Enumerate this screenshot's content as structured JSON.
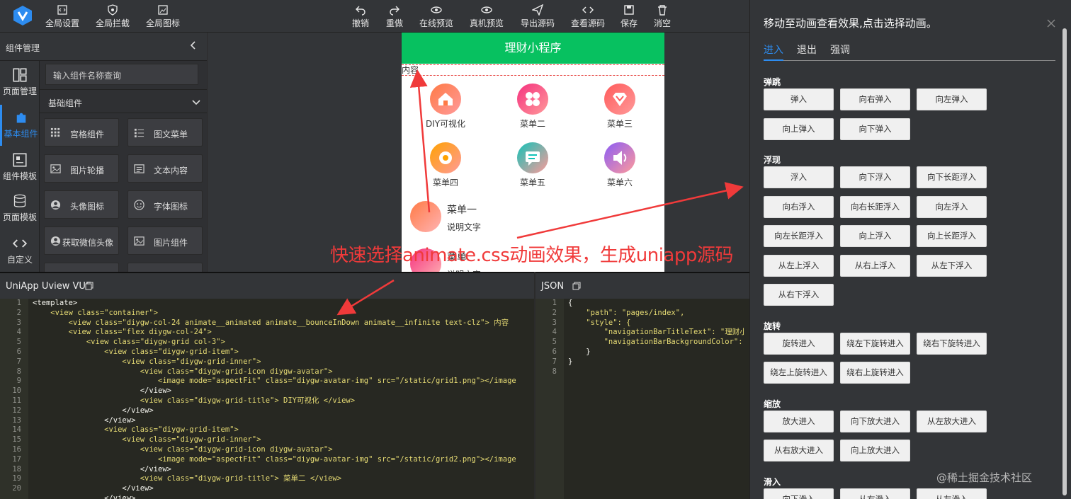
{
  "toolbar": {
    "left": [
      {
        "label": "全局设置",
        "icon": "code-file-icon"
      },
      {
        "label": "全局拦截",
        "icon": "shield-icon"
      },
      {
        "label": "全局图标",
        "icon": "image-box-icon"
      }
    ],
    "center": [
      {
        "label": "撤销",
        "icon": "undo-icon"
      },
      {
        "label": "重做",
        "icon": "redo-icon"
      },
      {
        "label": "在线预览",
        "icon": "eye-icon"
      },
      {
        "label": "真机预览",
        "icon": "eye-icon"
      },
      {
        "label": "导出源码",
        "icon": "send-icon"
      },
      {
        "label": "查看源码",
        "icon": "code-icon"
      },
      {
        "label": "保存",
        "icon": "save-icon"
      },
      {
        "label": "消空",
        "icon": "trash-icon"
      }
    ]
  },
  "sidebar": {
    "header": "组件管理",
    "items": [
      {
        "label": "页面管理",
        "icon": "layout-icon"
      },
      {
        "label": "基本组件",
        "icon": "puzzle-icon",
        "active": true
      },
      {
        "label": "组件模板",
        "icon": "template-icon"
      },
      {
        "label": "页面模板",
        "icon": "database-icon"
      },
      {
        "label": "自定义",
        "icon": "code-icon"
      }
    ]
  },
  "components": {
    "search_placeholder": "输入组件名称查询",
    "category": "基础组件",
    "items": [
      {
        "label": "宫格组件",
        "icon": "grid-icon"
      },
      {
        "label": "图文菜单",
        "icon": "list-icon"
      },
      {
        "label": "图片轮播",
        "icon": "image-icon"
      },
      {
        "label": "文本内容",
        "icon": "text-icon"
      },
      {
        "label": "头像图标",
        "icon": "avatar-icon"
      },
      {
        "label": "字体图标",
        "icon": "smile-icon"
      },
      {
        "label": "获取微信头像",
        "icon": "avatar-icon"
      },
      {
        "label": "图片组件",
        "icon": "image-icon"
      }
    ]
  },
  "phone": {
    "nav_title": "理财小程序",
    "content_text": "内容",
    "grid": [
      {
        "label": "DIY可视化",
        "color": "#ff7a45",
        "icon": "home-icon"
      },
      {
        "label": "菜单二",
        "color": "#f5317f",
        "icon": "clover-icon"
      },
      {
        "label": "菜单三",
        "color": "#ff5a5a",
        "icon": "heart-icon"
      },
      {
        "label": "菜单四",
        "color": "#ffa200",
        "icon": "flower-icon"
      },
      {
        "label": "菜单五",
        "color": "#12c2b7",
        "icon": "chat-icon"
      },
      {
        "label": "菜单六",
        "color": "#8b5cf6",
        "icon": "speaker-icon"
      }
    ],
    "list": [
      {
        "title": "菜单一",
        "sub": "说明文字",
        "color": "#ff7a45"
      },
      {
        "title": "菜单",
        "sub": "说明文字",
        "color": "#f5317f"
      }
    ]
  },
  "annotation": "快速选择animate.css动画效果，生成uniapp源码",
  "code_left": {
    "title": "UniApp Uview VUE",
    "line_numbers": [
      "1",
      "2",
      "3",
      "4",
      "5",
      "6",
      "7",
      "8",
      "9",
      "10",
      "11",
      "12",
      "13",
      "14",
      "15",
      "16",
      "17",
      "18",
      "19",
      "20"
    ],
    "lines": [
      "<template>",
      "    <view class=\"container\">",
      "        <view class=\"diygw-col-24 animate__animated animate__bounceInDown animate__infinite text-clz\"> 内容",
      "        <view class=\"flex diygw-col-24\">",
      "            <view class=\"diygw-grid col-3\">",
      "                <view class=\"diygw-grid-item\">",
      "                    <view class=\"diygw-grid-inner\">",
      "                        <view class=\"diygw-grid-icon diygw-avatar\">",
      "                            <image mode=\"aspectFit\" class=\"diygw-avatar-img\" src=\"/static/grid1.png\"></image",
      "                        </view>",
      "                        <view class=\"diygw-grid-title\"> DIY可视化 </view>",
      "                    </view>",
      "                </view>",
      "                <view class=\"diygw-grid-item\">",
      "                    <view class=\"diygw-grid-inner\">",
      "                        <view class=\"diygw-grid-icon diygw-avatar\">",
      "                            <image mode=\"aspectFit\" class=\"diygw-avatar-img\" src=\"/static/grid2.png\"></image",
      "                        </view>",
      "                        <view class=\"diygw-grid-title\"> 菜单二 </view>",
      "                    </view>",
      "                </view>"
    ]
  },
  "code_right": {
    "title": "JSON",
    "line_numbers": [
      "1",
      "2",
      "3",
      "4",
      "5",
      "6",
      "7",
      "8"
    ],
    "lines": [
      "{",
      "    \"path\": \"pages/index\",",
      "    \"style\": {",
      "        \"navigationBarTitleText\": \"理财小",
      "        \"navigationBarBackgroundColor\":",
      "    }",
      "}",
      ""
    ]
  },
  "anim_panel": {
    "title": "移动至动画查看效果,点击选择动画。",
    "tabs": [
      "进入",
      "退出",
      "强调"
    ],
    "sections": [
      {
        "name": "弹跳",
        "buttons": [
          "弹入",
          "向右弹入",
          "向左弹入",
          "向上弹入",
          "向下弹入"
        ]
      },
      {
        "name": "浮现",
        "buttons": [
          "浮入",
          "向下浮入",
          "向下长距浮入",
          "向右浮入",
          "向右长距浮入",
          "向左浮入",
          "向左长距浮入",
          "向上浮入",
          "向上长距浮入",
          "从左上浮入",
          "从右上浮入",
          "从左下浮入",
          "从右下浮入"
        ]
      },
      {
        "name": "旋转",
        "buttons": [
          "旋转进入",
          "绕左下旋转进入",
          "绕右下旋转进入",
          "绕左上旋转进入",
          "绕右上旋转进入"
        ]
      },
      {
        "name": "缩放",
        "buttons": [
          "放大进入",
          "向下放大进入",
          "从左放大进入",
          "从右放大进入",
          "向上放大进入"
        ]
      },
      {
        "name": "滑入",
        "buttons": [
          "向下滑入",
          "从右滑入",
          "从左滑入"
        ]
      }
    ]
  },
  "watermark": "@稀土掘金技术社区",
  "colors": {
    "accent": "#2d8cf0",
    "nav_green": "#07c160",
    "annotation_red": "#f03a3a"
  }
}
